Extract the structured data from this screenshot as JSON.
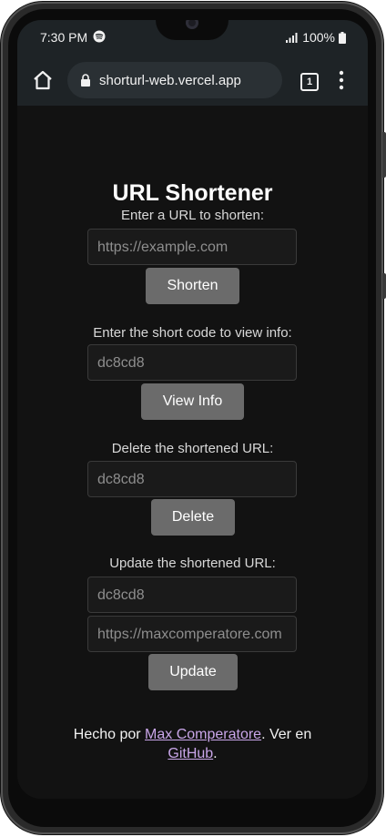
{
  "status_bar": {
    "time": "7:30 PM",
    "battery": "100%",
    "icons": [
      "spotify-icon",
      "signal-icon",
      "battery-icon"
    ]
  },
  "browser": {
    "url": "shorturl-web.vercel.app",
    "tab_count": "1",
    "icons": [
      "home-icon",
      "lock-icon",
      "tabs-icon",
      "more-vert-icon"
    ]
  },
  "page": {
    "title": "URL Shortener",
    "shorten": {
      "label": "Enter a URL to shorten:",
      "placeholder": "https://example.com",
      "button": "Shorten"
    },
    "info": {
      "label": "Enter the short code to view info:",
      "value": "dc8cd8",
      "button": "View Info"
    },
    "delete": {
      "label": "Delete the shortened URL:",
      "value": "dc8cd8",
      "button": "Delete"
    },
    "update": {
      "label": "Update the shortened URL:",
      "code_value": "dc8cd8",
      "url_value": "https://maxcomperatore.com",
      "button": "Update"
    },
    "footer": {
      "prefix": "Hecho por ",
      "author_link": "Max Comperatore",
      "middle": ". Ver en",
      "github_link": "GitHub",
      "suffix": "."
    }
  },
  "colors": {
    "page_background": "#121212",
    "browser_chrome": "#1e2326",
    "button_background": "#6b6b6b",
    "link": "#c9a6e9"
  }
}
